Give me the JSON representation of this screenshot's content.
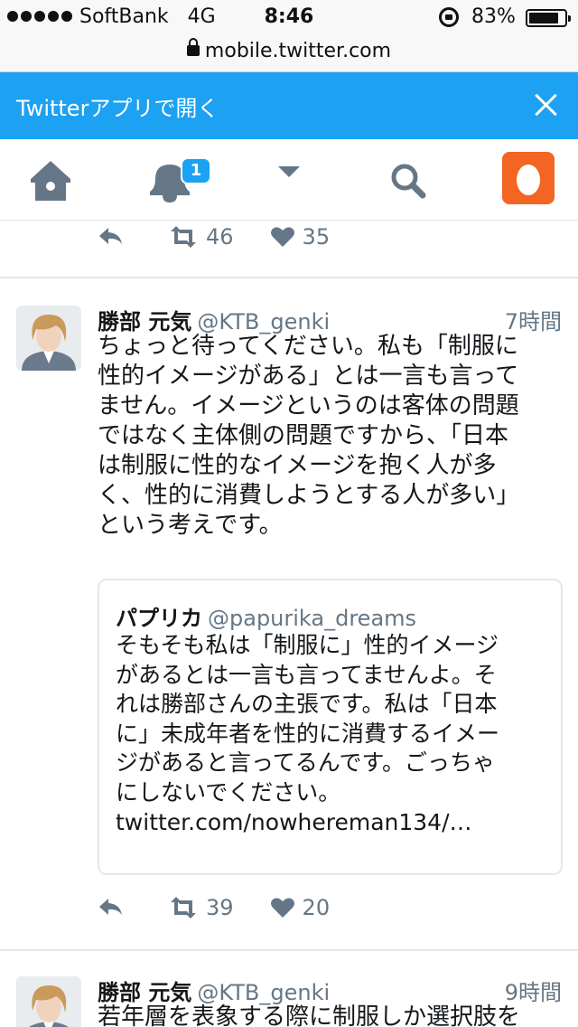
{
  "status_bar": {
    "carrier": "SoftBank",
    "network": "4G",
    "time": "8:46",
    "battery": "83%",
    "battery_level": 0.83
  },
  "browser": {
    "url": "mobile.twitter.com"
  },
  "banner": {
    "text": "Twitterアプリで開く"
  },
  "nav": {
    "notifications_badge": "1",
    "icons": [
      "home-icon",
      "notifications-icon",
      "dropdown-icon",
      "search-icon",
      "profile-icon"
    ]
  },
  "colors": {
    "twitter_blue": "#1da1f2",
    "gray": "#657786",
    "profile_orange": "#f26522"
  },
  "prev_tweet": {
    "retweets": "46",
    "likes": "35"
  },
  "tweets": [
    {
      "name": "勝部 元気",
      "handle": "@KTB_genki",
      "time": "7時間",
      "lines": [
        "ちょっと待ってください。私も「制服に",
        "性的イメージがある」とは一言も言って",
        "ません。イメージというのは客体の問題",
        "ではなく主体側の問題ですから、「日本",
        "は制服に性的なイメージを抱く人が多",
        "く、性的に消費しようとする人が多い」",
        "という考えです。"
      ],
      "quote": {
        "name": "パプリカ",
        "handle": "@papurika_dreams",
        "lines": [
          "そもそも私は「制服に」性的イメージ",
          "があるとは一言も言ってませんよ。そ",
          "れは勝部さんの主張です。私は「日本",
          "に」未成年者を性的に消費するイメー",
          "ジがあると言ってるんです。ごっちゃ",
          "にしないでください。",
          "twitter.com/nowhereman134/…"
        ]
      },
      "retweets": "39",
      "likes": "20"
    },
    {
      "name": "勝部 元気",
      "handle": "@KTB_genki",
      "time": "9時間",
      "lines": [
        "若年層を表象する際に制服しか選択肢を"
      ]
    }
  ]
}
